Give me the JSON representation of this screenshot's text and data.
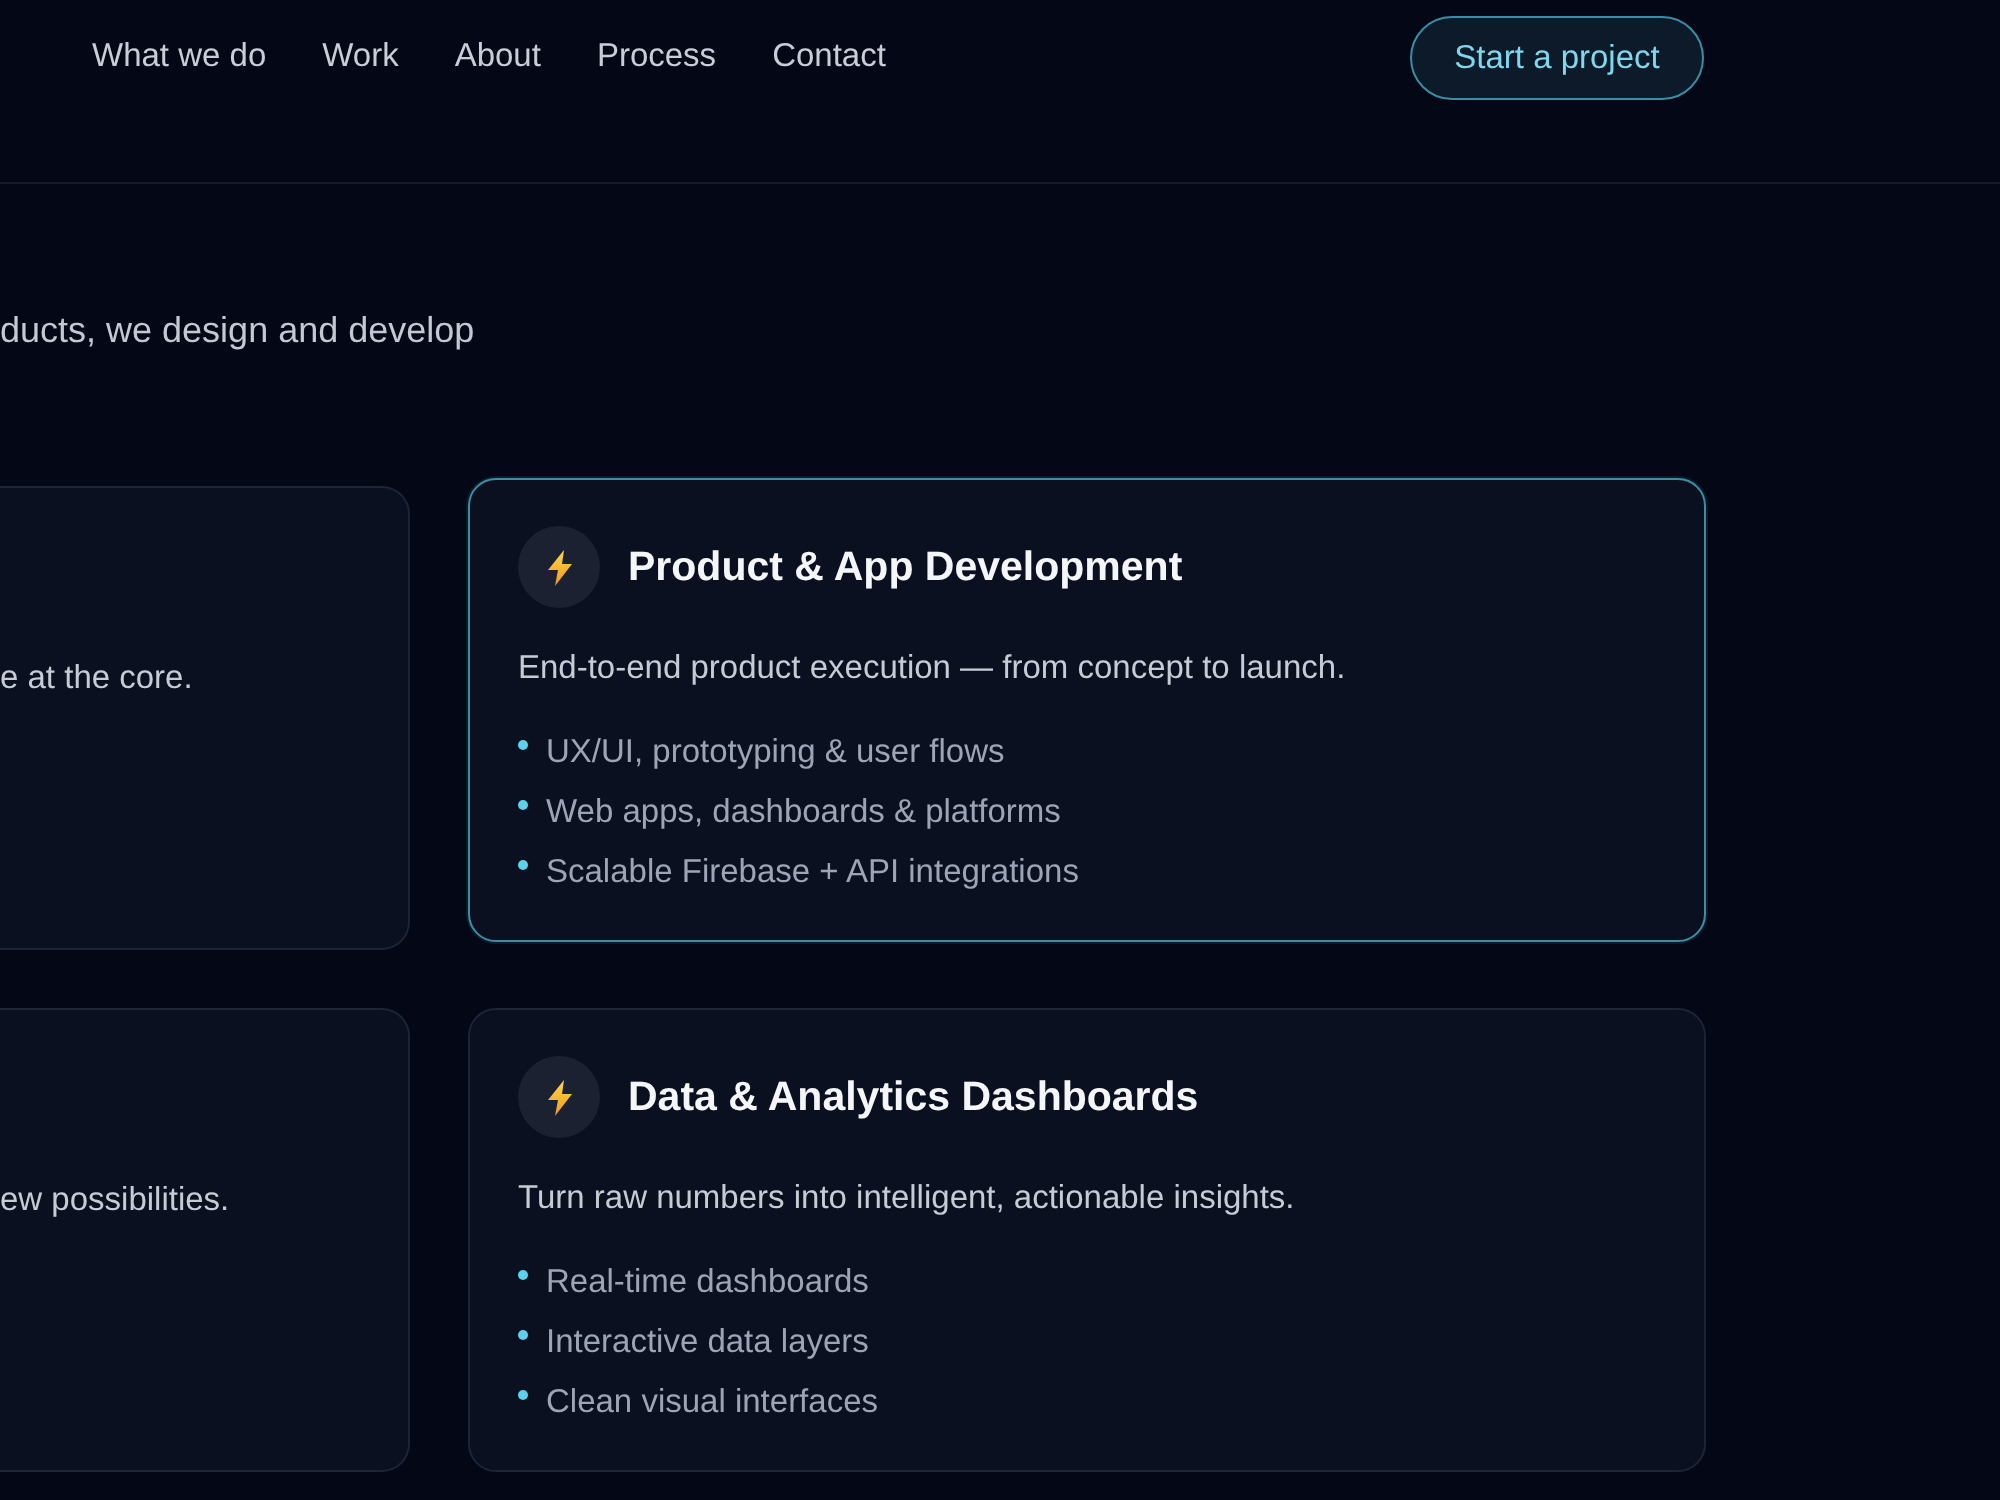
{
  "nav": {
    "links": [
      "What we do",
      "Work",
      "About",
      "Process",
      "Contact"
    ],
    "cta": "Start a project"
  },
  "intro": {
    "text": "ducts, we design and develop"
  },
  "cards": [
    {
      "kind": "partial",
      "description": "e at the core.",
      "highlighted": false
    },
    {
      "kind": "full",
      "title": "Product & App Development",
      "description": "End-to-end product execution — from concept to launch.",
      "items": [
        "UX/UI, prototyping & user flows",
        "Web apps, dashboards & platforms",
        "Scalable Firebase + API integrations"
      ],
      "highlighted": true
    },
    {
      "kind": "partial",
      "description": "ew possibilities.",
      "highlighted": false
    },
    {
      "kind": "full",
      "title": "Data & Analytics Dashboards",
      "description": "Turn raw numbers into intelligent, actionable insights.",
      "items": [
        "Real-time dashboards",
        "Interactive data layers",
        "Clean visual interfaces"
      ],
      "highlighted": false
    }
  ]
}
